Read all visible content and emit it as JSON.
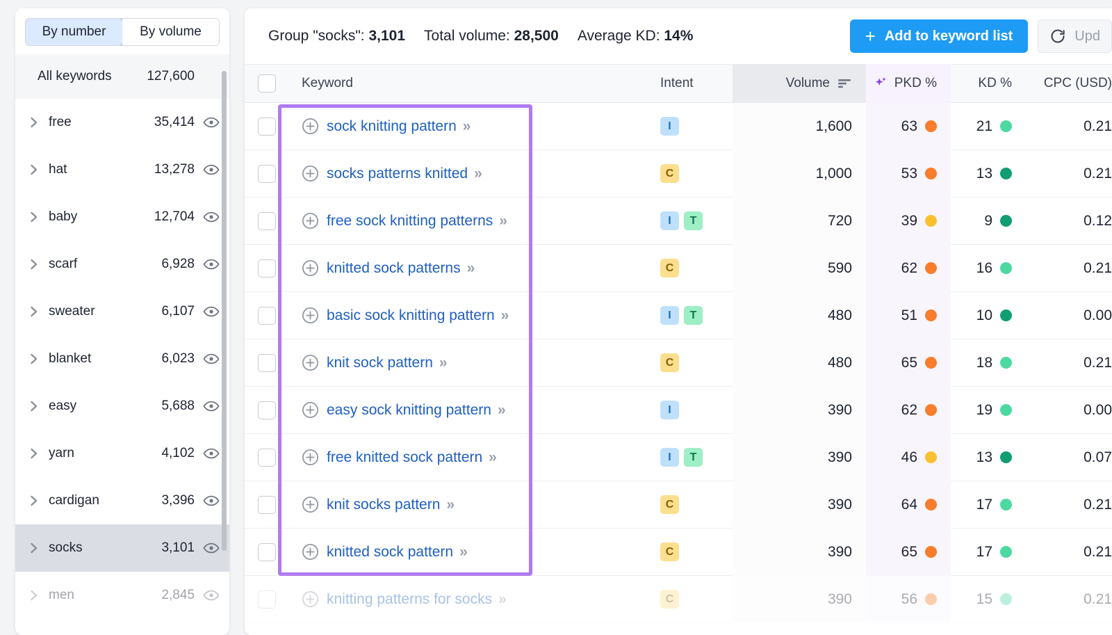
{
  "sidebar": {
    "toggle": {
      "by_number": "By number",
      "by_volume": "By volume",
      "active": "By number"
    },
    "all_keywords": {
      "label": "All keywords",
      "count": "127,600"
    },
    "items": [
      {
        "label": "free",
        "count": "35,414"
      },
      {
        "label": "hat",
        "count": "13,278"
      },
      {
        "label": "baby",
        "count": "12,704"
      },
      {
        "label": "scarf",
        "count": "6,928"
      },
      {
        "label": "sweater",
        "count": "6,107"
      },
      {
        "label": "blanket",
        "count": "6,023"
      },
      {
        "label": "easy",
        "count": "5,688"
      },
      {
        "label": "yarn",
        "count": "4,102"
      },
      {
        "label": "cardigan",
        "count": "3,396"
      },
      {
        "label": "socks",
        "count": "3,101"
      },
      {
        "label": "men",
        "count": "2,845"
      }
    ]
  },
  "topbar": {
    "group_label": "Group \"socks\":",
    "group_value": "3,101",
    "total_volume_label": "Total volume:",
    "total_volume_value": "28,500",
    "average_kd_label": "Average KD:",
    "average_kd_value": "14%",
    "add_button": "Add to keyword list",
    "add_button_plus": "+",
    "update_button": "Upd"
  },
  "table": {
    "headers": {
      "keyword": "Keyword",
      "intent": "Intent",
      "volume": "Volume",
      "pkd": "PKD %",
      "kd": "KD %",
      "cpc": "CPC (USD)"
    },
    "rows": [
      {
        "keyword": "sock knitting pattern",
        "intent": [
          "I"
        ],
        "volume": "1,600",
        "pkd": "63",
        "pkd_color": "#f97d2a",
        "kd": "21",
        "kd_color": "#4cd9a0",
        "cpc": "0.21"
      },
      {
        "keyword": "socks patterns knitted",
        "intent": [
          "C"
        ],
        "volume": "1,000",
        "pkd": "53",
        "pkd_color": "#f97d2a",
        "kd": "13",
        "kd_color": "#0f9d72",
        "cpc": "0.21"
      },
      {
        "keyword": "free sock knitting patterns",
        "intent": [
          "I",
          "T"
        ],
        "volume": "720",
        "pkd": "39",
        "pkd_color": "#fbc02d",
        "kd": "9",
        "kd_color": "#0f9d72",
        "cpc": "0.12"
      },
      {
        "keyword": "knitted sock patterns",
        "intent": [
          "C"
        ],
        "volume": "590",
        "pkd": "62",
        "pkd_color": "#f97d2a",
        "kd": "16",
        "kd_color": "#4cd9a0",
        "cpc": "0.21"
      },
      {
        "keyword": "basic sock knitting pattern",
        "intent": [
          "I",
          "T"
        ],
        "volume": "480",
        "pkd": "51",
        "pkd_color": "#f97d2a",
        "kd": "10",
        "kd_color": "#0f9d72",
        "cpc": "0.00"
      },
      {
        "keyword": "knit sock pattern",
        "intent": [
          "C"
        ],
        "volume": "480",
        "pkd": "65",
        "pkd_color": "#f97d2a",
        "kd": "18",
        "kd_color": "#4cd9a0",
        "cpc": "0.21"
      },
      {
        "keyword": "easy sock knitting pattern",
        "intent": [
          "I"
        ],
        "volume": "390",
        "pkd": "62",
        "pkd_color": "#f97d2a",
        "kd": "19",
        "kd_color": "#4cd9a0",
        "cpc": "0.00"
      },
      {
        "keyword": "free knitted sock pattern",
        "intent": [
          "I",
          "T"
        ],
        "volume": "390",
        "pkd": "46",
        "pkd_color": "#fbc02d",
        "kd": "13",
        "kd_color": "#0f9d72",
        "cpc": "0.07"
      },
      {
        "keyword": "knit socks pattern",
        "intent": [
          "C"
        ],
        "volume": "390",
        "pkd": "64",
        "pkd_color": "#f97d2a",
        "kd": "17",
        "kd_color": "#4cd9a0",
        "cpc": "0.21"
      },
      {
        "keyword": "knitted sock pattern",
        "intent": [
          "C"
        ],
        "volume": "390",
        "pkd": "65",
        "pkd_color": "#f97d2a",
        "kd": "17",
        "kd_color": "#4cd9a0",
        "cpc": "0.21"
      },
      {
        "keyword": "knitting patterns for socks",
        "intent": [
          "C"
        ],
        "volume": "390",
        "pkd": "56",
        "pkd_color": "#f97d2a",
        "kd": "15",
        "kd_color": "#4cd9a0",
        "cpc": "0.21"
      }
    ],
    "expand_glyph": "»"
  },
  "annotation": {
    "highlight_color": "#b07bf0"
  }
}
